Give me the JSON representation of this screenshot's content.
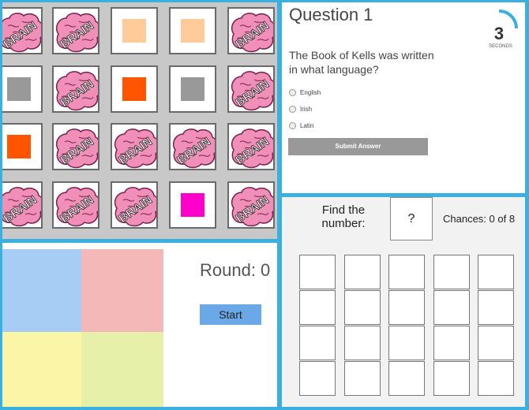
{
  "memory_game": {
    "brain_text": "BRAIN",
    "cards": [
      [
        "brain",
        "brain",
        "square:#ffcc99",
        "square:#ffcc99",
        "brain"
      ],
      [
        "square:#999999",
        "brain",
        "square:#ff5500",
        "square:#999999",
        "brain"
      ],
      [
        "square:#ff5500",
        "brain",
        "brain",
        "brain",
        "brain"
      ],
      [
        "brain",
        "brain",
        "brain",
        "square:#ff00cc",
        "brain"
      ]
    ],
    "colors": {
      "brain_pink": "#f08fb8",
      "brain_outline": "#7a2050"
    }
  },
  "quiz": {
    "title": "Question 1",
    "question": "The Book of Kells was written in what language?",
    "timer_value": "3",
    "timer_label": "SECONDS",
    "options": [
      "English",
      "Irish",
      "Latin"
    ],
    "submit_label": "Submit Answer",
    "accent": "#3ab0e0"
  },
  "simon": {
    "round_label": "Round: 0",
    "start_label": "Start",
    "quadrant_colors": [
      "#a8cdf5",
      "#f5b8b8",
      "#fbf5a8",
      "#e6f0a8"
    ]
  },
  "find_number": {
    "find_label": "Find the number:",
    "mystery": "?",
    "chances": "Chances: 0 of 8",
    "columns": 5,
    "rows": 4
  }
}
